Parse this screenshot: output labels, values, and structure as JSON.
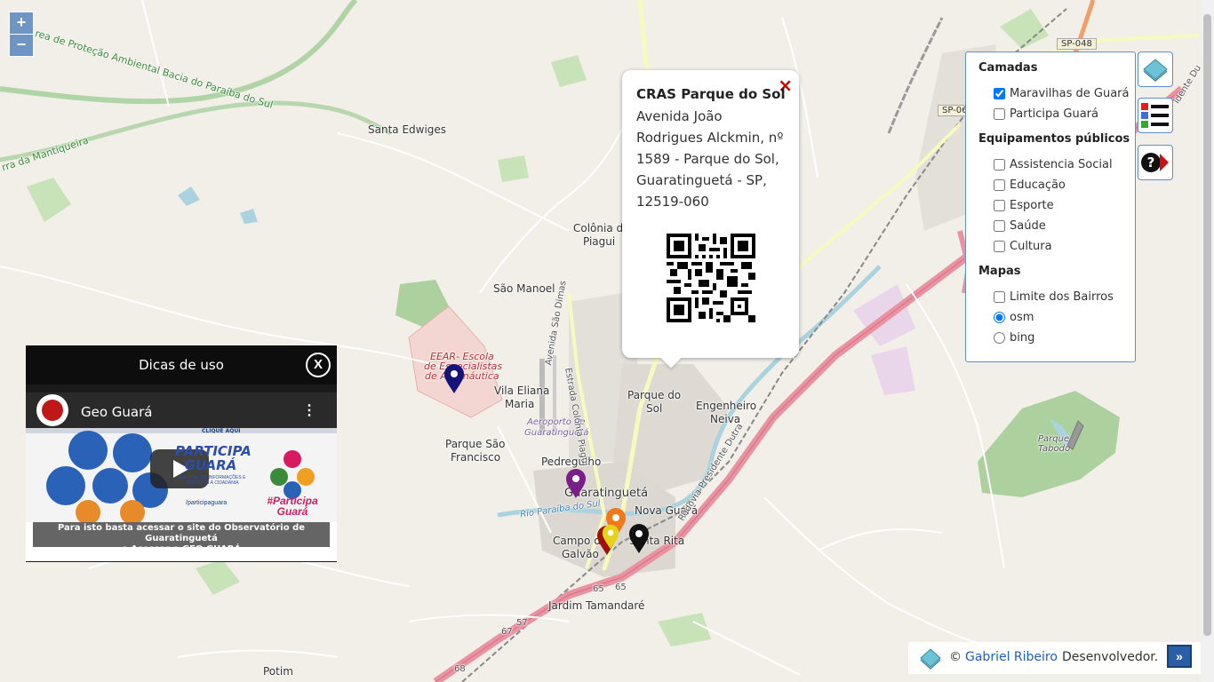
{
  "map": {
    "zoom_in": "+",
    "zoom_out": "−",
    "places": {
      "santa_edwiges": "Santa Edwiges",
      "colonia_piagui_1": "Colônia do",
      "colonia_piagui_2": "Piagui",
      "sao_manoel": "São Manoel",
      "vila_eliana_1": "Vila Eliana",
      "vila_eliana_2": "Maria",
      "parque_sao_francisco_1": "Parque São",
      "parque_sao_francisco_2": "Francisco",
      "pedregulho": "Pedregulho",
      "guaratingueta": "Guaratinguetá",
      "nova_guara": "Nova Guará",
      "campo_galvao_1": "Campo de",
      "campo_galvao_2": "Galvão",
      "santa_rita": "Santa Rita",
      "parque_do_sol_1": "Parque do",
      "parque_do_sol_2": "Sol",
      "engenheiro_neiva_1": "Engenheiro",
      "engenheiro_neiva_2": "Neiva",
      "jardim_tamandare": "Jardim Tamandaré",
      "potim": "Potim",
      "parque_tabodo_1": "Parque",
      "parque_tabodo_2": "Tabodo",
      "aeroporto_1": "Aeroporto de",
      "aeroporto_2": "Guaratinguetá",
      "eear_1": "EEAR- Escola",
      "eear_2": "de Especialistas",
      "eear_3": "de Aeronáutica",
      "apa": "rea de Proteção Ambiental Bacia do Paraíba do Sul",
      "serra": "rra da Mantiqueira",
      "rio": "Rio Paraíba do Sul",
      "av_sao_dimas": "Avenida São Dimas",
      "estrada_piagui": "Estrada Colônia Piagui",
      "rodovia_dutra": "Rodovia Presidente Dutra",
      "rodovia_dutra_top": "idente Du",
      "sp048": "SP-048",
      "sp06": "SP-06",
      "r65a": "65",
      "r65b": "65",
      "r67": "67",
      "r57": "57",
      "r68": "68"
    }
  },
  "popup": {
    "close": "×",
    "title": "CRAS Parque do Sol",
    "address": "Avenida João Rodrigues Alckmin, nº 1589 - Parque do Sol, Guaratinguetá - SP, 12519-060"
  },
  "layers": {
    "section_camadas": "Camadas",
    "maravilhas": "Maravilhas de Guará",
    "participa": "Participa Guará",
    "section_equip": "Equipamentos públicos",
    "assistencia": "Assistencia Social",
    "educacao": "Educação",
    "esporte": "Esporte",
    "saude": "Saúde",
    "cultura": "Cultura",
    "section_mapas": "Mapas",
    "limite": "Limite dos Bairros",
    "osm": "osm",
    "bing": "bing"
  },
  "video": {
    "header": "Dicas de uso",
    "close": "X",
    "channel_title": "Geo Guará",
    "banner": "PARTICIPA GUARÁ",
    "banner_sub": "CENTRAL DE INFORMAÇÕES E SERVIÇOS À CIDADANIA",
    "logo_text": "#Participa Guará",
    "handle": "/participaguara",
    "clique": "CLIQUE AQUI",
    "caption_1": "Para isto basta acessar o site do Observatório de Guaratinguetá",
    "caption_2": "e Acessar o GEO GUARÁ"
  },
  "attribution": {
    "copyright": "©",
    "author": "Gabriel Ribeiro",
    "role": "Desenvolvedor.",
    "expand": "»"
  },
  "colors": {
    "primary_road": "#e892a2",
    "secondary_road": "#f7fabf",
    "water": "#aad3df",
    "park": "#add19e",
    "accent": "#5b8fd0"
  }
}
